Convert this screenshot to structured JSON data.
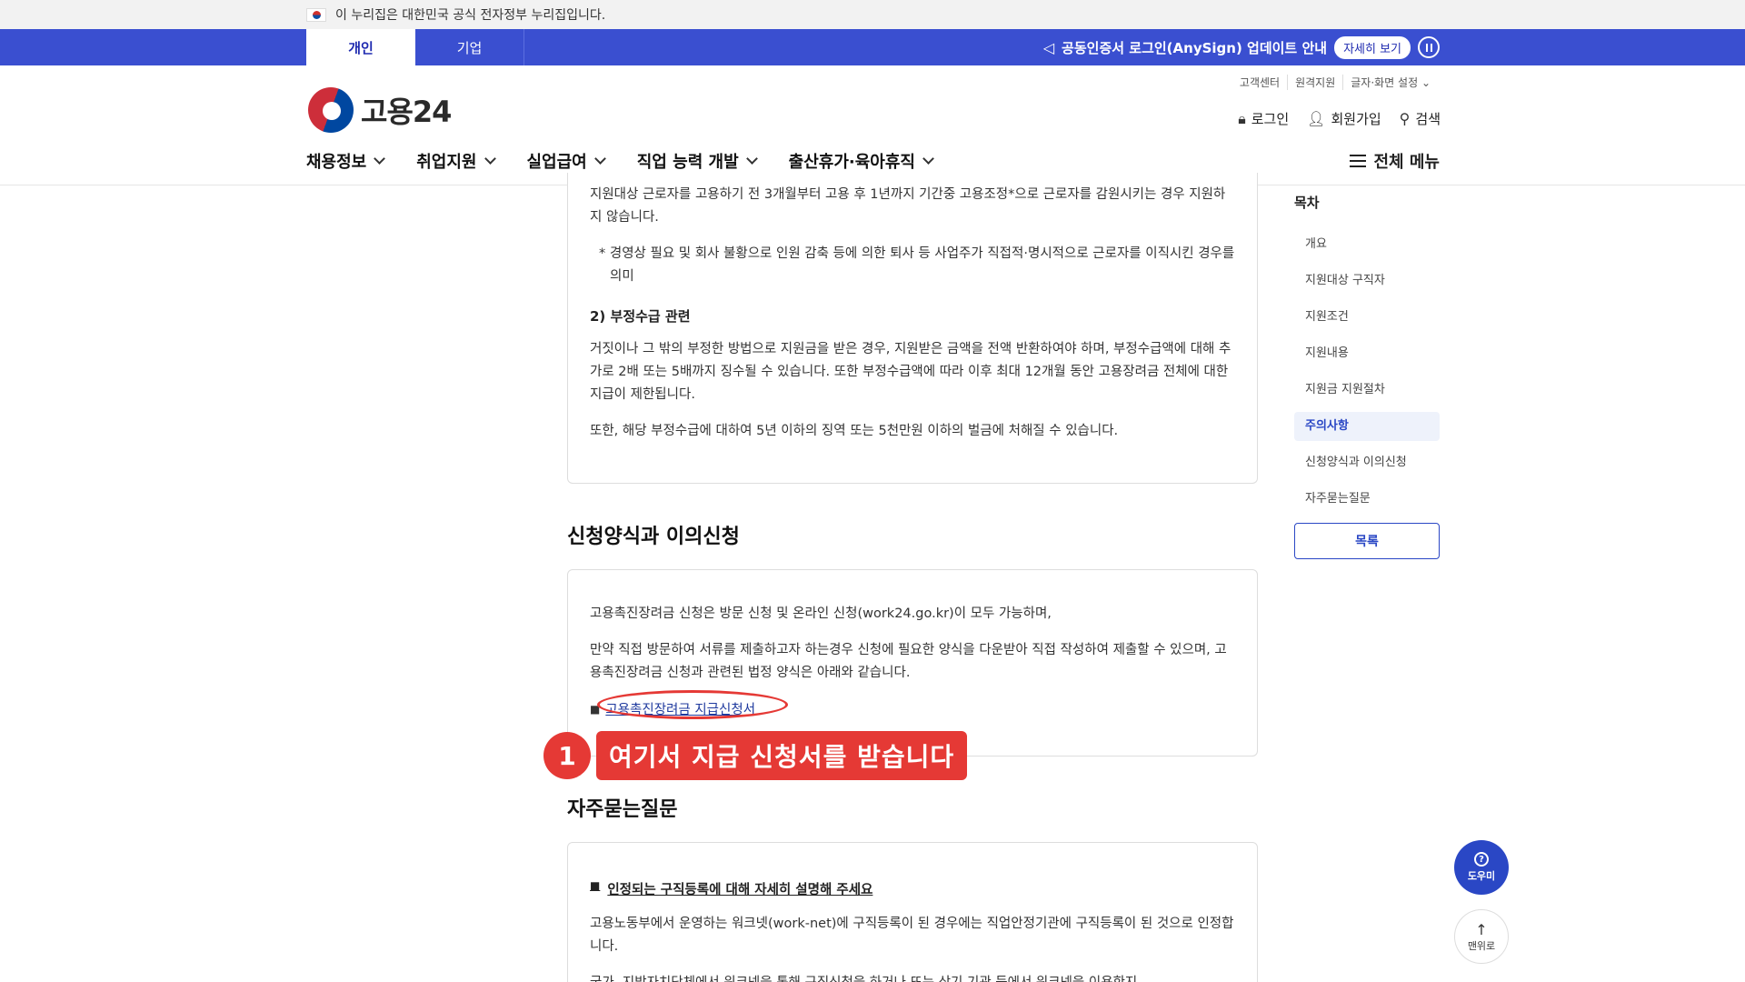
{
  "gov_strip": {
    "text": "이 누리집은 대한민국 공식 전자정부 누리집입니다."
  },
  "top_tabs": {
    "personal": "개인",
    "company": "기업"
  },
  "notice": {
    "text": "공동인증서 로그인(AnySign) 업데이트 안내",
    "detail_button": "자세히 보기"
  },
  "util_links": [
    "고객센터",
    "원격지원",
    "글자·화면 설정"
  ],
  "logo": {
    "text": "고용24"
  },
  "user_actions": {
    "login": "로그인",
    "signup": "회원가입",
    "search": "검색"
  },
  "gnb": [
    "채용정보",
    "취업지원",
    "실업급여",
    "직업 능력 개발",
    "출산휴가·육아휴직"
  ],
  "all_menu": "전체 메뉴",
  "box1": {
    "para1": "지원대상 근로자를 고용하기 전 3개월부터 고용 후 1년까지 기간중 고용조정*으로 근로자를 감원시키는 경우 지원하지 않습니다.",
    "note": "* 경영상 필요 및 회사 불황으로 인원 감축 등에 의한 퇴사 등 사업주가 직접적·명시적으로 근로자를 이직시킨 경우를 의미",
    "sub_heading": "2) 부정수급 관련",
    "para2": "거짓이나 그 밖의 부정한 방법으로 지원금을 받은 경우, 지원받은 금액을 전액 반환하여야 하며, 부정수급액에 대해 추가로 2배 또는 5배까지 징수될 수 있습니다. 또한 부정수급액에 따라 이후 최대 12개월 동안 고용장려금 전체에 대한 지급이 제한됩니다.",
    "para3": "또한, 해당 부정수급에 대하여 5년 이하의 징역 또는 5천만원 이하의 벌금에 처해질 수 있습니다."
  },
  "section2": {
    "title": "신청양식과 이의신청",
    "para1": "고용촉진장려금 신청은 방문 신청 및 온라인 신청(work24.go.kr)이 모두 가능하며,",
    "para2": "만약 직접 방문하여 서류를 제출하고자 하는경우 신청에 필요한 양식을 다운받아 직접 작성하여 제출할 수 있으며, 고용촉진장려금 신청과 관련된 법정 양식은 아래와 같습니다.",
    "bullet": "■",
    "link": "고용촉진장려금 지급신청서"
  },
  "annotation": {
    "number": "1",
    "text": "여기서 지급 신청서를 받습니다"
  },
  "section3": {
    "title": "자주묻는질문",
    "bullet": "■",
    "question": "인정되는 구직등록에 대해 자세히 설명해 주세요",
    "answer": "고용노동부에서 운영하는 워크넷(work-net)에 구직등록이 된 경우에는 직업안정기관에 구직등록이 된 것으로 인정합니다.",
    "answer2": "국가, 지방자치단체에서 워크넷을 통해 구직신청을 하거나 또는 상기 기관 등에서 워크넷을 이용한지"
  },
  "toc": {
    "title": "목차",
    "items": [
      "개요",
      "지원대상 구직자",
      "지원조건",
      "지원내용",
      "지원금 지원절차",
      "주의사항",
      "신청양식과 이의신청",
      "자주묻는질문"
    ],
    "active_index": 5,
    "list_button": "목록"
  },
  "float": {
    "help": "도우미",
    "top": "맨위로"
  },
  "colors": {
    "primary": "#3a4fd0",
    "annotation": "#e53935"
  }
}
